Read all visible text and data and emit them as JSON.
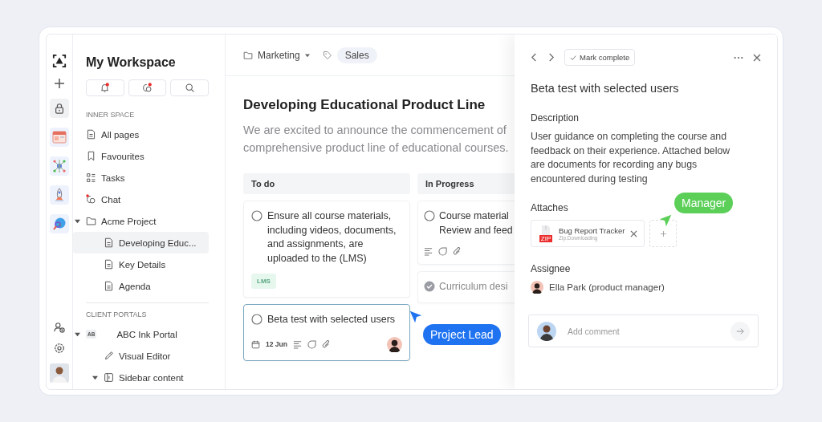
{
  "sidebar": {
    "title": "My Workspace",
    "tools": [
      {
        "kind": "bell",
        "badge": true
      },
      {
        "kind": "chat",
        "badge": true
      },
      {
        "kind": "search",
        "badge": false
      }
    ],
    "sections": [
      {
        "heading": "INNER SPACE",
        "items": [
          {
            "label": "All pages",
            "kind": "page",
            "selected": false,
            "badge": false
          },
          {
            "label": "Favourites",
            "kind": "bookmark",
            "selected": false,
            "badge": false
          },
          {
            "label": "Tasks",
            "kind": "tasks",
            "selected": false,
            "badge": false
          },
          {
            "label": "Chat",
            "kind": "chat",
            "selected": false,
            "badge": true
          },
          {
            "label": "Acme Project",
            "kind": "folder",
            "selected": false,
            "badge": false,
            "expanded": true,
            "children": [
              {
                "label": "Developing Educ...",
                "kind": "page",
                "selected": true,
                "badge": false
              },
              {
                "label": "Key Details",
                "kind": "page",
                "selected": false,
                "badge": false
              },
              {
                "label": "Agenda",
                "kind": "page",
                "selected": false,
                "badge": false
              }
            ]
          }
        ]
      },
      {
        "heading": "CLIENT PORTALS",
        "items": [
          {
            "label": "ABC Ink Portal",
            "kind": "portal",
            "initials": "AB",
            "selected": false,
            "badge": false,
            "expanded": true,
            "children": [
              {
                "label": "Visual Editor",
                "kind": "pen",
                "selected": false,
                "badge": false
              },
              {
                "label": "Sidebar content",
                "kind": "section",
                "selected": false,
                "badge": false,
                "expanded": true
              }
            ]
          }
        ]
      }
    ]
  },
  "header": {
    "folder": "Marketing",
    "tag": "Sales"
  },
  "document": {
    "title": "Developing Educational Product Line",
    "intro_lines": [
      "We are excited to announce the commencement of",
      "comprehensive product line of educational courses."
    ]
  },
  "board": {
    "columns": [
      {
        "title": "To do",
        "cards": [
          {
            "text": "Ensure all course materials, including videos, documents, and assignments, are uploaded to the (LMS)",
            "done": false,
            "selected": false,
            "tag": "LMS",
            "meta": false
          },
          {
            "text": "Beta test with selected users",
            "done": false,
            "selected": true,
            "date": "12 Jun",
            "meta": true,
            "avatar": true
          }
        ]
      },
      {
        "title": "In Progress",
        "cards": [
          {
            "lines": [
              "Course material",
              "Review and feed"
            ],
            "done": false,
            "selected": false,
            "meta": true
          },
          {
            "lines": [
              "Curriculum desi"
            ],
            "done": true,
            "selected": false,
            "meta": false
          }
        ]
      }
    ]
  },
  "panel": {
    "action": "Mark complete",
    "title": "Beta test with selected users",
    "description_heading": "Description",
    "description": "User guidance on completing the course and feedback on their experience. Attached below are documents for recording any bugs encountered during testing",
    "attaches_heading": "Attaches",
    "attachments": [
      {
        "name": "Bug Report Tracker",
        "status": "Zip.Downloading",
        "type": "ZIP"
      }
    ],
    "assignee_heading": "Assignee",
    "assignee": "Ella Park (product manager)",
    "comment": {
      "placeholder": "Add comment"
    }
  },
  "cursors": [
    {
      "label": "Project Lead",
      "color": "#1f73f0"
    },
    {
      "label": "Manager",
      "color": "#5bcf58"
    }
  ]
}
